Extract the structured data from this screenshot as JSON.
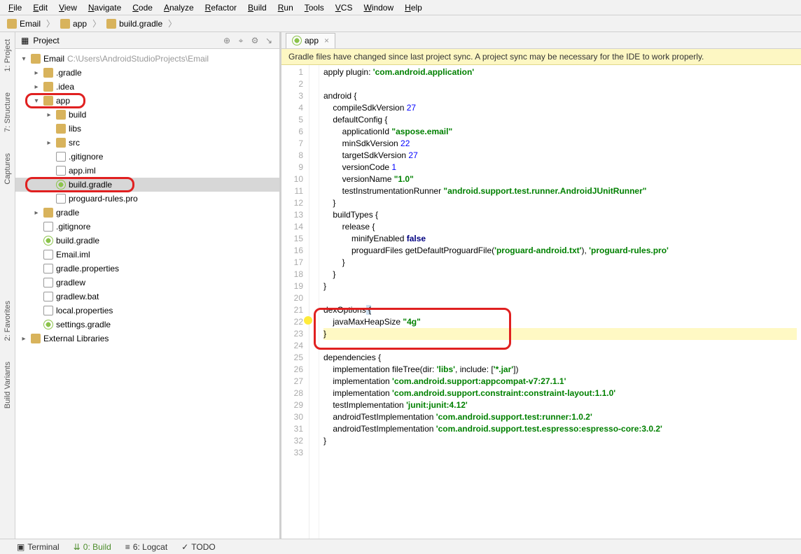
{
  "menu": [
    "File",
    "Edit",
    "View",
    "Navigate",
    "Code",
    "Analyze",
    "Refactor",
    "Build",
    "Run",
    "Tools",
    "VCS",
    "Window",
    "Help"
  ],
  "breadcrumbs": [
    {
      "icon": "folder",
      "label": "Email"
    },
    {
      "icon": "folder",
      "label": "app"
    },
    {
      "icon": "gradle",
      "label": "build.gradle"
    }
  ],
  "left_rail": {
    "project": "1: Project",
    "structure": "7: Structure",
    "captures": "Captures",
    "favorites": "2: Favorites",
    "build_variants": "Build Variants"
  },
  "project_panel": {
    "title": "Project"
  },
  "tree": [
    {
      "ind": 0,
      "arr": "▾",
      "ico": "folder",
      "label": "Email",
      "suffix": "C:\\Users\\AndroidStudioProjects\\Email"
    },
    {
      "ind": 1,
      "arr": "▸",
      "ico": "folder",
      "label": ".gradle"
    },
    {
      "ind": 1,
      "arr": "▸",
      "ico": "folder",
      "label": ".idea"
    },
    {
      "ind": 1,
      "arr": "▾",
      "ico": "folder",
      "label": "app"
    },
    {
      "ind": 2,
      "arr": "▸",
      "ico": "folder",
      "label": "build"
    },
    {
      "ind": 2,
      "arr": "",
      "ico": "folder",
      "label": "libs"
    },
    {
      "ind": 2,
      "arr": "▸",
      "ico": "folder",
      "label": "src"
    },
    {
      "ind": 2,
      "arr": "",
      "ico": "file",
      "label": ".gitignore"
    },
    {
      "ind": 2,
      "arr": "",
      "ico": "file",
      "label": "app.iml"
    },
    {
      "ind": 2,
      "arr": "",
      "ico": "gradle",
      "label": "build.gradle",
      "sel": true
    },
    {
      "ind": 2,
      "arr": "",
      "ico": "file",
      "label": "proguard-rules.pro"
    },
    {
      "ind": 1,
      "arr": "▸",
      "ico": "folder",
      "label": "gradle"
    },
    {
      "ind": 1,
      "arr": "",
      "ico": "file",
      "label": ".gitignore"
    },
    {
      "ind": 1,
      "arr": "",
      "ico": "gradle",
      "label": "build.gradle"
    },
    {
      "ind": 1,
      "arr": "",
      "ico": "file",
      "label": "Email.iml"
    },
    {
      "ind": 1,
      "arr": "",
      "ico": "file",
      "label": "gradle.properties"
    },
    {
      "ind": 1,
      "arr": "",
      "ico": "file",
      "label": "gradlew"
    },
    {
      "ind": 1,
      "arr": "",
      "ico": "file",
      "label": "gradlew.bat"
    },
    {
      "ind": 1,
      "arr": "",
      "ico": "file",
      "label": "local.properties"
    },
    {
      "ind": 1,
      "arr": "",
      "ico": "gradle",
      "label": "settings.gradle"
    },
    {
      "ind": 0,
      "arr": "▸",
      "ico": "lib",
      "label": "External Libraries"
    }
  ],
  "editor_tab": "app",
  "banner": "Gradle files have changed since last project sync. A project sync may be necessary for the IDE to work properly.",
  "bottom": {
    "terminal": "Terminal",
    "build": "0: Build",
    "logcat": "6: Logcat",
    "todo": "TODO"
  },
  "code_lines": [
    {
      "n": 1,
      "h": "apply <span class='fn'>plugin</span>: <span class='str'>'com.android.application'</span>"
    },
    {
      "n": 2,
      "h": ""
    },
    {
      "n": 3,
      "h": "android {"
    },
    {
      "n": 4,
      "h": "    compileSdkVersion <span class='num'>27</span>"
    },
    {
      "n": 5,
      "h": "    defaultConfig {"
    },
    {
      "n": 6,
      "h": "        applicationId <span class='str'>\"aspose.email\"</span>"
    },
    {
      "n": 7,
      "h": "        minSdkVersion <span class='num'>22</span>"
    },
    {
      "n": 8,
      "h": "        targetSdkVersion <span class='num'>27</span>"
    },
    {
      "n": 9,
      "h": "        versionCode <span class='num'>1</span>"
    },
    {
      "n": 10,
      "h": "        versionName <span class='str'>\"1.0\"</span>"
    },
    {
      "n": 11,
      "h": "        testInstrumentationRunner <span class='str'>\"android.support.test.runner.AndroidJUnitRunner\"</span>"
    },
    {
      "n": 12,
      "h": "    }"
    },
    {
      "n": 13,
      "h": "    buildTypes {"
    },
    {
      "n": 14,
      "h": "        release {"
    },
    {
      "n": 15,
      "h": "            minifyEnabled <span class='kw'>false</span>"
    },
    {
      "n": 16,
      "h": "            proguardFiles getDefaultProguardFile(<span class='str'>'proguard-android.txt'</span>), <span class='str'>'proguard-rules.pro'</span>"
    },
    {
      "n": 17,
      "h": "        }"
    },
    {
      "n": 18,
      "h": "    }"
    },
    {
      "n": 19,
      "h": "}"
    },
    {
      "n": 20,
      "h": ""
    },
    {
      "n": 21,
      "h": "dexOptions<span style='background:#cde'> {</span>"
    },
    {
      "n": 22,
      "h": "    javaMaxHeapSize <span class='str'>\"4g\"</span>"
    },
    {
      "n": 23,
      "h": "<span class='sel-code'>}</span>"
    },
    {
      "n": 24,
      "h": ""
    },
    {
      "n": 25,
      "h": "dependencies {"
    },
    {
      "n": 26,
      "h": "    implementation fileTree(<span class='fn'>dir</span>: <span class='str'>'libs'</span>, <span class='fn'>include</span>: [<span class='str'>'*.jar'</span>])"
    },
    {
      "n": 27,
      "h": "    implementation <span class='str'>'com.android.support:appcompat-v7:27.1.1'</span>"
    },
    {
      "n": 28,
      "h": "    implementation <span class='str'>'com.android.support.constraint:constraint-layout:1.1.0'</span>"
    },
    {
      "n": 29,
      "h": "    testImplementation <span class='str'>'junit:junit:4.12'</span>"
    },
    {
      "n": 30,
      "h": "    androidTestImplementation <span class='str'>'com.android.support.test:runner:1.0.2'</span>"
    },
    {
      "n": 31,
      "h": "    androidTestImplementation <span class='str'>'com.android.support.test.espresso:espresso-core:3.0.2'</span>"
    },
    {
      "n": 32,
      "h": "}"
    },
    {
      "n": 33,
      "h": ""
    }
  ]
}
